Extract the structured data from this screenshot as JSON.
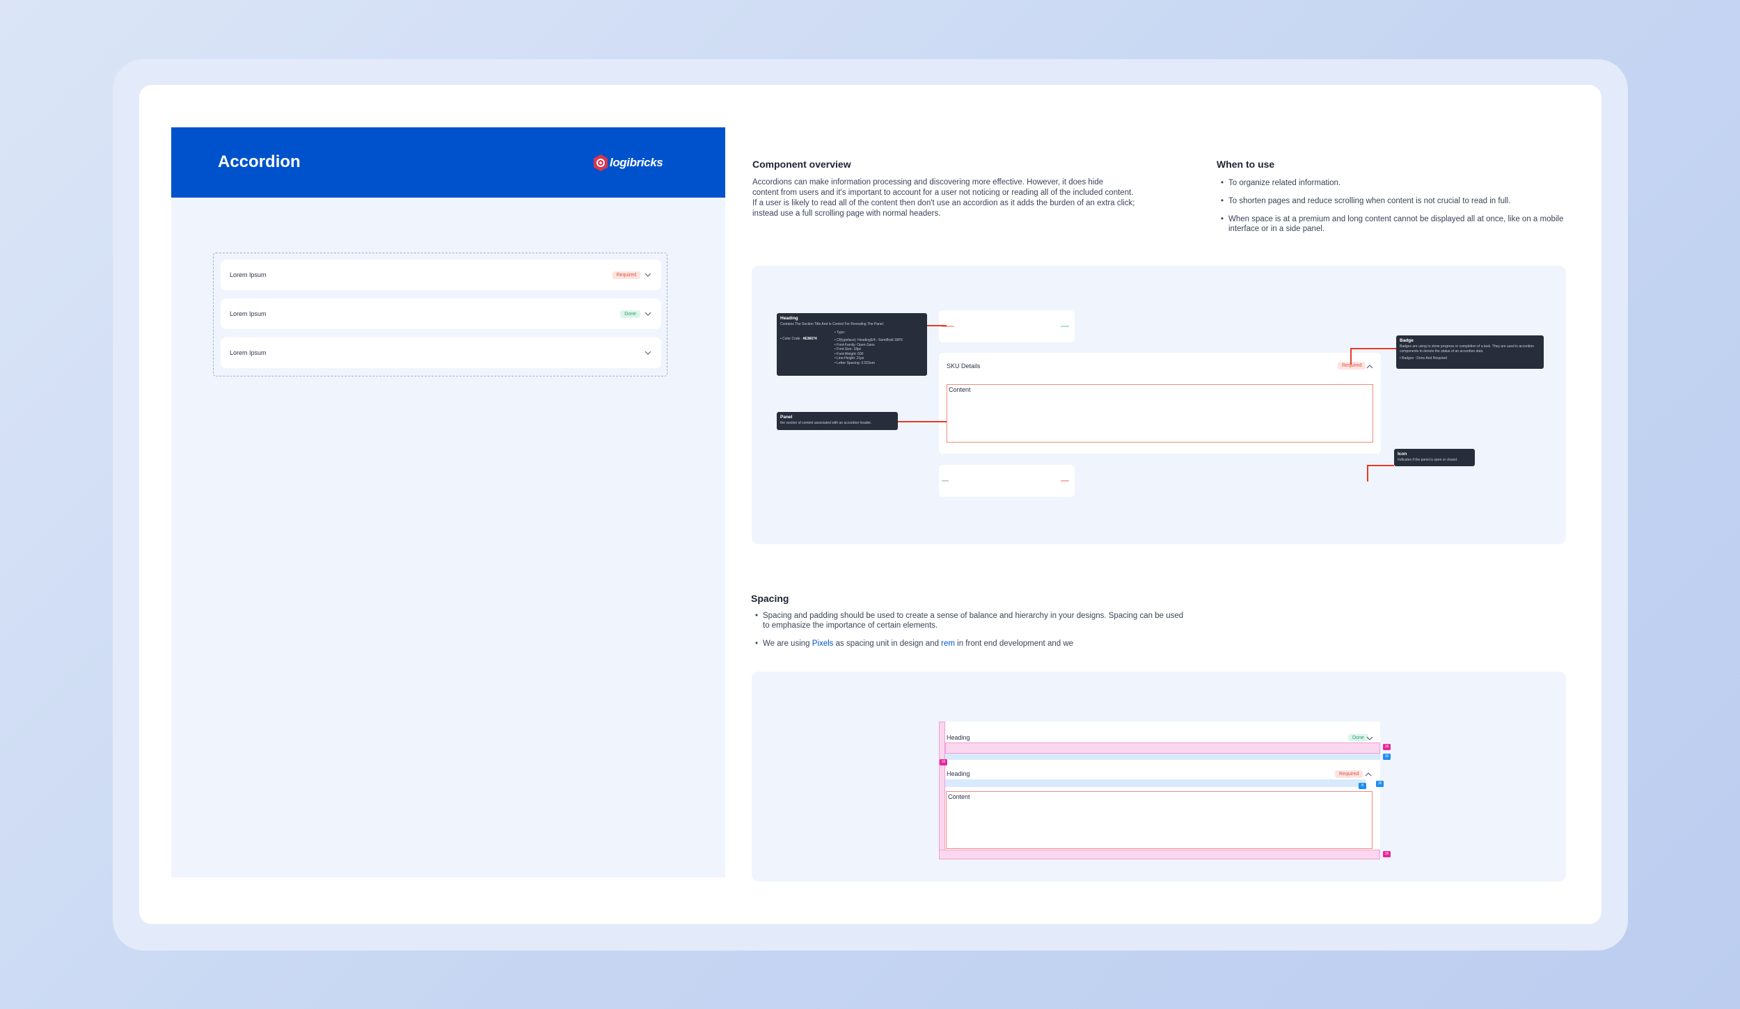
{
  "header": {
    "title": "Accordion",
    "logo_text": "logibricks"
  },
  "demo": {
    "items": [
      {
        "label": "Lorem Ipsum",
        "badge": "Required",
        "badge_type": "required"
      },
      {
        "label": "Lorem Ipsum",
        "badge": "Done",
        "badge_type": "done"
      },
      {
        "label": "Lorem Ipsum",
        "badge": "",
        "badge_type": "none"
      }
    ]
  },
  "overview": {
    "title": "Component overview",
    "lines": [
      "Accordions can make information processing and discovering more effective. However, it does hide",
      "content from users and it's important to account for a user not noticing or reading all of the included content.",
      "If a user is likely to read all of the content then don't use an accordion as it adds the burden of an extra click;",
      "instead use a full scrolling page with normal headers."
    ]
  },
  "when_to_use": {
    "title": "When to use",
    "items": [
      "To organize related information.",
      "To shorten pages and reduce scrolling when content is not crucial to read in full.",
      "When space is at a premium and long content cannot be displayed all at once, like on a mobile interface or in a side panel."
    ]
  },
  "anatomy": {
    "panel_title": "SKU Details",
    "badge": "Required",
    "content_label": "Content",
    "heading_callout": {
      "title": "Heading",
      "desc": "Contains The Section Title And Is Control For Revealing The Panel.",
      "color_label": "Color Code",
      "color_code": "#E36074",
      "typo_label": "Typo :",
      "typo_items": [
        "Cf(typeface): Heading5/4 - SemiBold 18PX",
        "Font-Family: Open-Sans",
        "Font-Size: 18px",
        "Font-Weight: 600",
        "Line-Height: 21px",
        "Letter-Spacing: 0.015em"
      ]
    },
    "panel_callout": {
      "title": "Panel",
      "desc": "the section of content associated with an accordion header."
    },
    "badge_callout": {
      "title": "Badge",
      "desc": "Badges are using to show progress or completion of a task. They are used in accordion components to denote the status of an accordion data",
      "item": "Badges : Done And Required"
    },
    "icon_callout": {
      "title": "Icon",
      "desc": "Indicates if the panel is open or closed."
    }
  },
  "spacing": {
    "title": "Spacing",
    "bullet1": "Spacing and padding should be used to create a sense of balance and hierarchy in your designs. Spacing can be used to emphasize the importance of certain elements.",
    "bullet2_pre": "We are using ",
    "bullet2_pixels": "Pixels",
    "bullet2_mid": " as spacing unit in design and ",
    "bullet2_rem": "rem",
    "bullet2_post": " in front end development and we",
    "heading1": "Heading",
    "heading1_badge": "Done",
    "heading2": "Heading",
    "heading2_badge": "Required",
    "content_label": "Content",
    "tags": {
      "t1": "16",
      "t2": "16",
      "t3": "16",
      "t4": "8",
      "t5": "16",
      "t6": "16"
    }
  },
  "colors": {
    "brand": "#0052cc",
    "required": "#e0533f",
    "done": "#2f9c6b",
    "callout_bg": "#272d3a",
    "redline": "#e53a23"
  }
}
